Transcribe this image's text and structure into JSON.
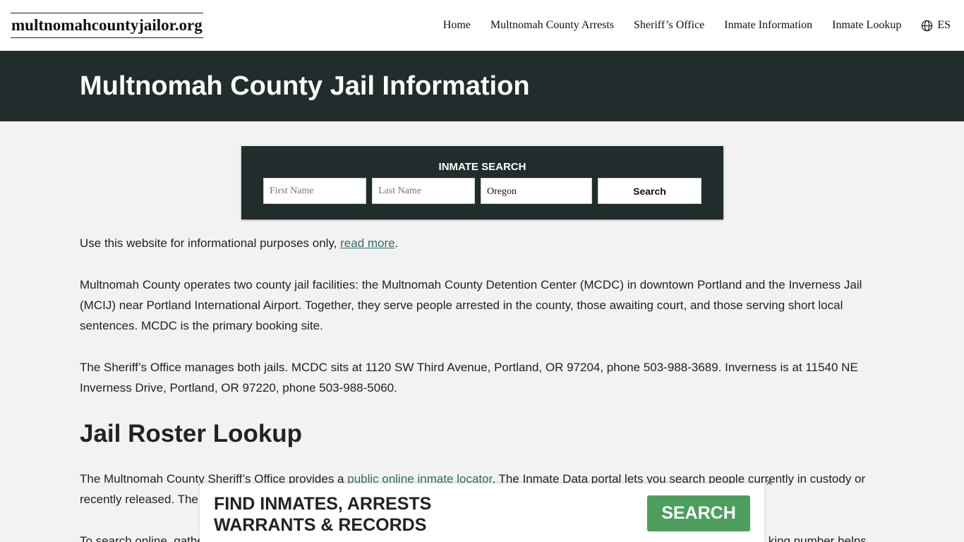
{
  "header": {
    "logo": "multnomahcountyjailor.org",
    "nav": [
      "Home",
      "Multnomah County Arrests",
      "Sheriff’s Office",
      "Inmate Information",
      "Inmate Lookup"
    ],
    "language": "ES",
    "language_icon": "globe-icon"
  },
  "hero": {
    "title": "Multnomah County Jail Information"
  },
  "search": {
    "title": "INMATE SEARCH",
    "first_placeholder": "First Name",
    "last_placeholder": "Last Name",
    "state": "Oregon",
    "button": "Search"
  },
  "content": {
    "p1_text": "Use this website for informational purposes only, ",
    "p1_link": "read more",
    "p1_end": ".",
    "p2": "Multnomah County operates two county jail facilities: the Multnomah County Detention Center (MCDC) in downtown Portland and the Inverness Jail (MCIJ) near Portland International Airport. Together, they serve people arrested in the county, those awaiting court, and those serving short local sentences. MCDC is the primary booking site.",
    "p3": "The Sheriff’s Office manages both jails. MCDC sits at 1120 SW Third Avenue, Portland, OR 97204, phone 503-988-3689. Inverness is at 11540 NE Inverness Drive, Portland, OR 97220, phone 503-988-5060.",
    "h2": "Jail Roster Lookup",
    "p4_text": "The Multnomah County Sheriff’s Office provides a ",
    "p4_link": "public online inmate locator",
    "p4_end": ". The Inmate Data portal lets you search people currently in custody or recently released. The",
    "p5_start": "To search online, gathe",
    "p5_end": "king number helps"
  },
  "ad": {
    "line1": "FIND INMATES, ARRESTS",
    "line2": "WARRANTS & RECORDS",
    "button": "SEARCH",
    "close": "×",
    "button_color": "#4d9e5c"
  },
  "colors": {
    "hero_bg": "#212d2d",
    "link": "#2e6d6a",
    "page_bg": "#f2f2f2"
  }
}
